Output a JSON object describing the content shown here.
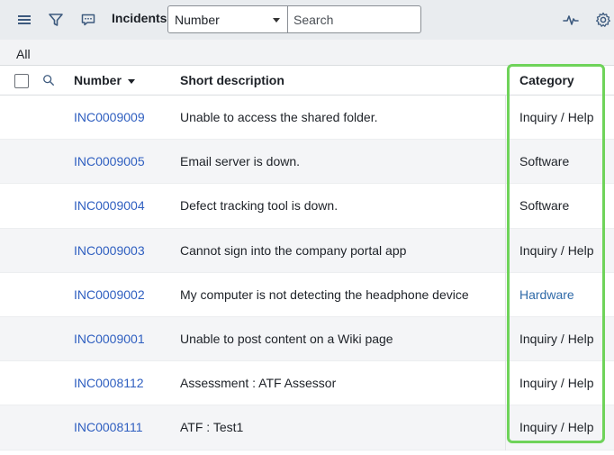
{
  "toolbar": {
    "title": "Incidents",
    "field_select_value": "Number",
    "search_placeholder": "Search",
    "icons": [
      "hamburger-menu-icon",
      "filter-icon",
      "chat-icon",
      "activity-pulse-icon",
      "gear-icon"
    ]
  },
  "breadcrumb": {
    "label": "All"
  },
  "columns": {
    "number": "Number",
    "description": "Short description",
    "category": "Category"
  },
  "rows": [
    {
      "number": "INC0009009",
      "description": "Unable to access the shared folder.",
      "category": "Inquiry / Help"
    },
    {
      "number": "INC0009005",
      "description": "Email server is down.",
      "category": "Software"
    },
    {
      "number": "INC0009004",
      "description": "Defect tracking tool is down.",
      "category": "Software"
    },
    {
      "number": "INC0009003",
      "description": "Cannot sign into the company portal app",
      "category": "Inquiry / Help"
    },
    {
      "number": "INC0009002",
      "description": "My computer is not detecting the headphone device",
      "category": "Hardware"
    },
    {
      "number": "INC0009001",
      "description": "Unable to post content on a Wiki page",
      "category": "Inquiry / Help"
    },
    {
      "number": "INC0008112",
      "description": "Assessment : ATF Assessor",
      "category": "Inquiry / Help"
    },
    {
      "number": "INC0008111",
      "description": "ATF : Test1",
      "category": "Inquiry / Help"
    }
  ],
  "colors": {
    "link": "#2f5fc0",
    "highlight": "#6fd35a",
    "toolbar_bg": "#e9ecef"
  }
}
